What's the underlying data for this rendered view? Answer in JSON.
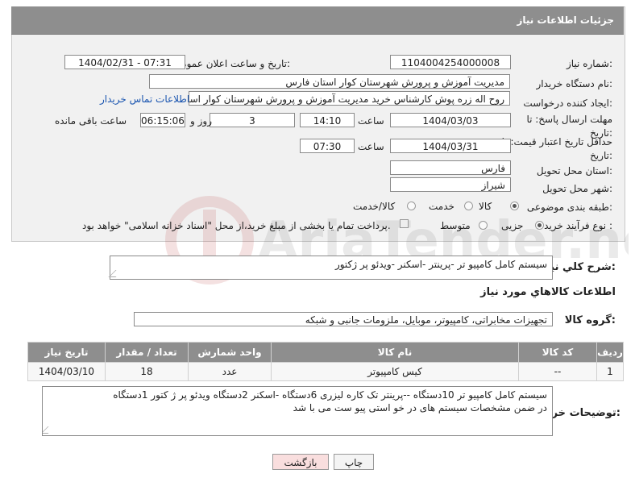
{
  "header": {
    "title": "جزئیات اطلاعات نیاز"
  },
  "form": {
    "need_number": {
      "label": "شماره نیاز:",
      "value": "1104004254000008"
    },
    "announce_datetime": {
      "label": "تاریخ و ساعت اعلان عمومی:",
      "value": "1404/02/31 - 07:31"
    },
    "buyer_org": {
      "label": "نام دستگاه خریدار:",
      "value": "مدیریت آموزش و پرورش شهرستان کوار استان فارس"
    },
    "requester": {
      "label": "ایجاد کننده درخواست:",
      "value": "روح اله زره پوش کارشناس خرید مدیریت آموزش و پرورش شهرستان کوار استان فارس"
    },
    "contact_link": "اطلاعات تماس خریدار",
    "reply_deadline": {
      "label": "مهلت ارسال پاسخ: تا تاریخ:",
      "date": "1404/03/03",
      "time_label": "ساعت",
      "time": "14:10",
      "days": "3",
      "days_label": "روز و",
      "remaining": "06:15:06",
      "remaining_label": "ساعت باقی مانده"
    },
    "price_validity": {
      "label": "حداقل تاریخ اعتبار قیمت: تا تاریخ:",
      "date": "1404/03/31",
      "time_label": "ساعت",
      "time": "07:30"
    },
    "province": {
      "label": "استان محل تحویل:",
      "value": "فارس"
    },
    "city": {
      "label": "شهر محل تحویل:",
      "value": "شیراز"
    },
    "category": {
      "label": "طبقه بندی موضوعی:",
      "options": [
        "کالا",
        "خدمت",
        "کالا/خدمت"
      ],
      "selected": "کالا"
    },
    "process_type": {
      "label": "نوع فرآیند خرید :",
      "options": [
        "جزیی",
        "متوسط"
      ],
      "selected": "جزیی",
      "note": "پرداخت تمام یا بخشی از مبلغ خرید،از محل \"اسناد خزانه اسلامی\" خواهد بود."
    }
  },
  "need_desc": {
    "label": "شرح كلي نياز:",
    "value": "سیستم کامل کامپیو تر -پرینتر -اسکنر -ویدئو پر ژکتور"
  },
  "goods_info_title": "اطلاعات كالاهاي مورد نياز",
  "goods_group": {
    "label": "گروه کالا:",
    "value": "تجهیزات مخابراتی، کامپیوتر، موبایل، ملزومات جانبی و شبکه"
  },
  "table": {
    "headers": [
      "ردیف",
      "کد کالا",
      "نام کالا",
      "واحد شمارش",
      "تعداد / مقدار",
      "تاریخ نیاز"
    ],
    "rows": [
      [
        "1",
        "--",
        "کیس کامپیوتر",
        "عدد",
        "18",
        "1404/03/10"
      ]
    ]
  },
  "buyer_notes": {
    "label": "توضیحات خریدار:",
    "line1": "سیستم کامل کامپیو تر 10دستگاه --پرینتر تک کاره لیزری 6دستگاه -اسکنر 2دستگاه ویدئو پر ژ کتور 1دستگاه",
    "line2": "در ضمن مشخصات سیستم های در خو استی پیو ست می با شد"
  },
  "buttons": {
    "print": "چاپ",
    "back": "بازگشت"
  },
  "colors": {
    "header_bg": "#8e8e8e",
    "link": "#1a55b0",
    "back_btn_bg": "#f9dede"
  }
}
